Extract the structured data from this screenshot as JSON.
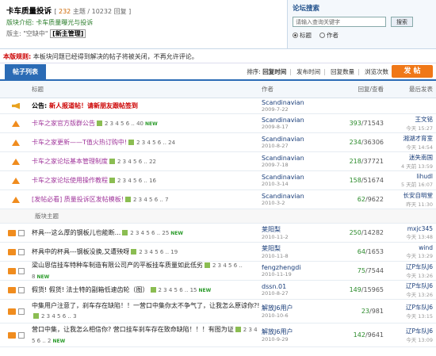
{
  "forum": {
    "name": "卡车质量投诉",
    "stat_pre": "[",
    "topics": "232",
    "topics_suffix": "主题 /",
    "posts": "10232",
    "posts_suffix": "回复 ]",
    "intro": "版块介绍: 卡车质量曝光与投诉",
    "mods_label": "版主:",
    "mods_placeholder": "\"空缺中\"",
    "mod_name": "[新主管理]"
  },
  "search": {
    "label": "论坛搜索",
    "placeholder": "请输入查询关键字",
    "button": "搜索",
    "opt_title": "标题",
    "opt_author": "作者"
  },
  "notice": {
    "label": "本版规则:",
    "text": "本板块问题已经得到解决的帖子将被关闭，不再允许评论。"
  },
  "tabs": {
    "active": "帖子列表"
  },
  "sort": {
    "label": "排序:",
    "opt1": "回复时间",
    "opt2": "发布时间",
    "opt3": "回复数量",
    "opt4": "浏览次数"
  },
  "post_button": "发 帖",
  "columns": {
    "title": "标题",
    "author": "作者",
    "reply": "回复/查看",
    "last": "最后发表"
  },
  "announce": {
    "pre": "公告:",
    "text": "新人报道帖！请新朋友跟帖签到",
    "author": "Scandinavian",
    "date": "2009-7-22"
  },
  "top_rows": [
    {
      "title": "卡车之家官方版群公告",
      "pages": "2 3 4 5 6 .. 40",
      "new": "NEW",
      "author": "Scandinavian",
      "date": "2009-8-17",
      "replies": "393",
      "views": "71543",
      "last_user": "王文铭",
      "last_time": "今天 15:27"
    },
    {
      "title": "卡车之家更新——T值火热订购中!",
      "pages": "2 3 4 5 6 .. 24",
      "new": "",
      "author": "Scandinavian",
      "date": "2010-8-27",
      "replies": "234",
      "views": "36306",
      "last_user": "湘湖才育室",
      "last_time": "今天 14:54"
    },
    {
      "title": "卡车之家论坛基本管理制度",
      "pages": "2 3 4 5 6 .. 22",
      "new": "",
      "author": "Scandinavian",
      "date": "2009-7-18",
      "replies": "218",
      "views": "37721",
      "last_user": "迷失南国",
      "last_time": "4 天前 13:59"
    },
    {
      "title": "卡车之家论坛使用操作教程",
      "pages": "2 3 4 5 6 .. 16",
      "new": "",
      "author": "Scandinavian",
      "date": "2010-3-14",
      "replies": "158",
      "views": "51674",
      "last_user": "lihudl",
      "last_time": "5 天前 16:07"
    },
    {
      "title": "[发帖必看] 质量投诉区发帖模板!",
      "pages": "2 3 4 5 6 .. 7",
      "new": "",
      "author": "Scandinavian",
      "date": "2010-3-2",
      "replies": "62",
      "views": "9622",
      "last_user": "长安自明堂",
      "last_time": "昨天 11:30"
    }
  ],
  "section_label": "版块主题",
  "rows": [
    {
      "title": "杯具---这么厚的钢板儿也能断...",
      "pages": "2 3 4 5 6 .. 25",
      "new": "NEW",
      "author": "莱阳梨",
      "date": "2010-11-2",
      "replies": "250",
      "views": "14282",
      "last_user": "mxjc345",
      "last_time": "今天 13:48"
    },
    {
      "title": "杯具中的杯具---钢板没换,又遭殃呀",
      "pages": "2 3 4 5 6 .. 19",
      "new": "",
      "author": "莱阳梨",
      "date": "2010-11-8",
      "replies": "64",
      "views": "1653",
      "last_user": "wind",
      "last_time": "今天 13:29"
    },
    {
      "title": "梁山恩信挂车特种车制造有限公司产的平板挂车质量如此低劣",
      "pages": "2 3 4 5 6 .. 8",
      "new": "NEW",
      "author": "fengzhengdi",
      "date": "2010-11-19",
      "replies": "75",
      "views": "7544",
      "last_user": "辽P车队J6",
      "last_time": "今天 13:26"
    },
    {
      "title": "假货! 假货! 法士特的副箱低速齿轮（图）",
      "pages": "2 3 4 5 6 .. 15",
      "new": "NEW",
      "author": "dssn.01",
      "date": "2010-8-27",
      "replies": "149",
      "views": "15965",
      "last_user": "辽P车队J6",
      "last_time": "今天 13:26"
    },
    {
      "title": "中集用户注意了，刹车存在缺陷！！一营口中集你太不争气了，让我怎么原谅你?!",
      "pages": "2 3 4 5 6 .. 3",
      "new": "",
      "author": "解放J6用户",
      "date": "2010-10-6",
      "replies": "23",
      "views": "981",
      "last_user": "辽P车队J6",
      "last_time": "今天 13:15"
    },
    {
      "title": "营口中集，让我怎么相信你? 营口挂车刹车存在致命缺陷！！！有图为证",
      "pages": "2 3 4 5 6 .. 2",
      "new": "NEW",
      "author": "解放J6用户",
      "date": "2010-9-29",
      "replies": "142",
      "views": "9641",
      "last_user": "辽P车队J6",
      "last_time": "今天 13:09"
    }
  ]
}
